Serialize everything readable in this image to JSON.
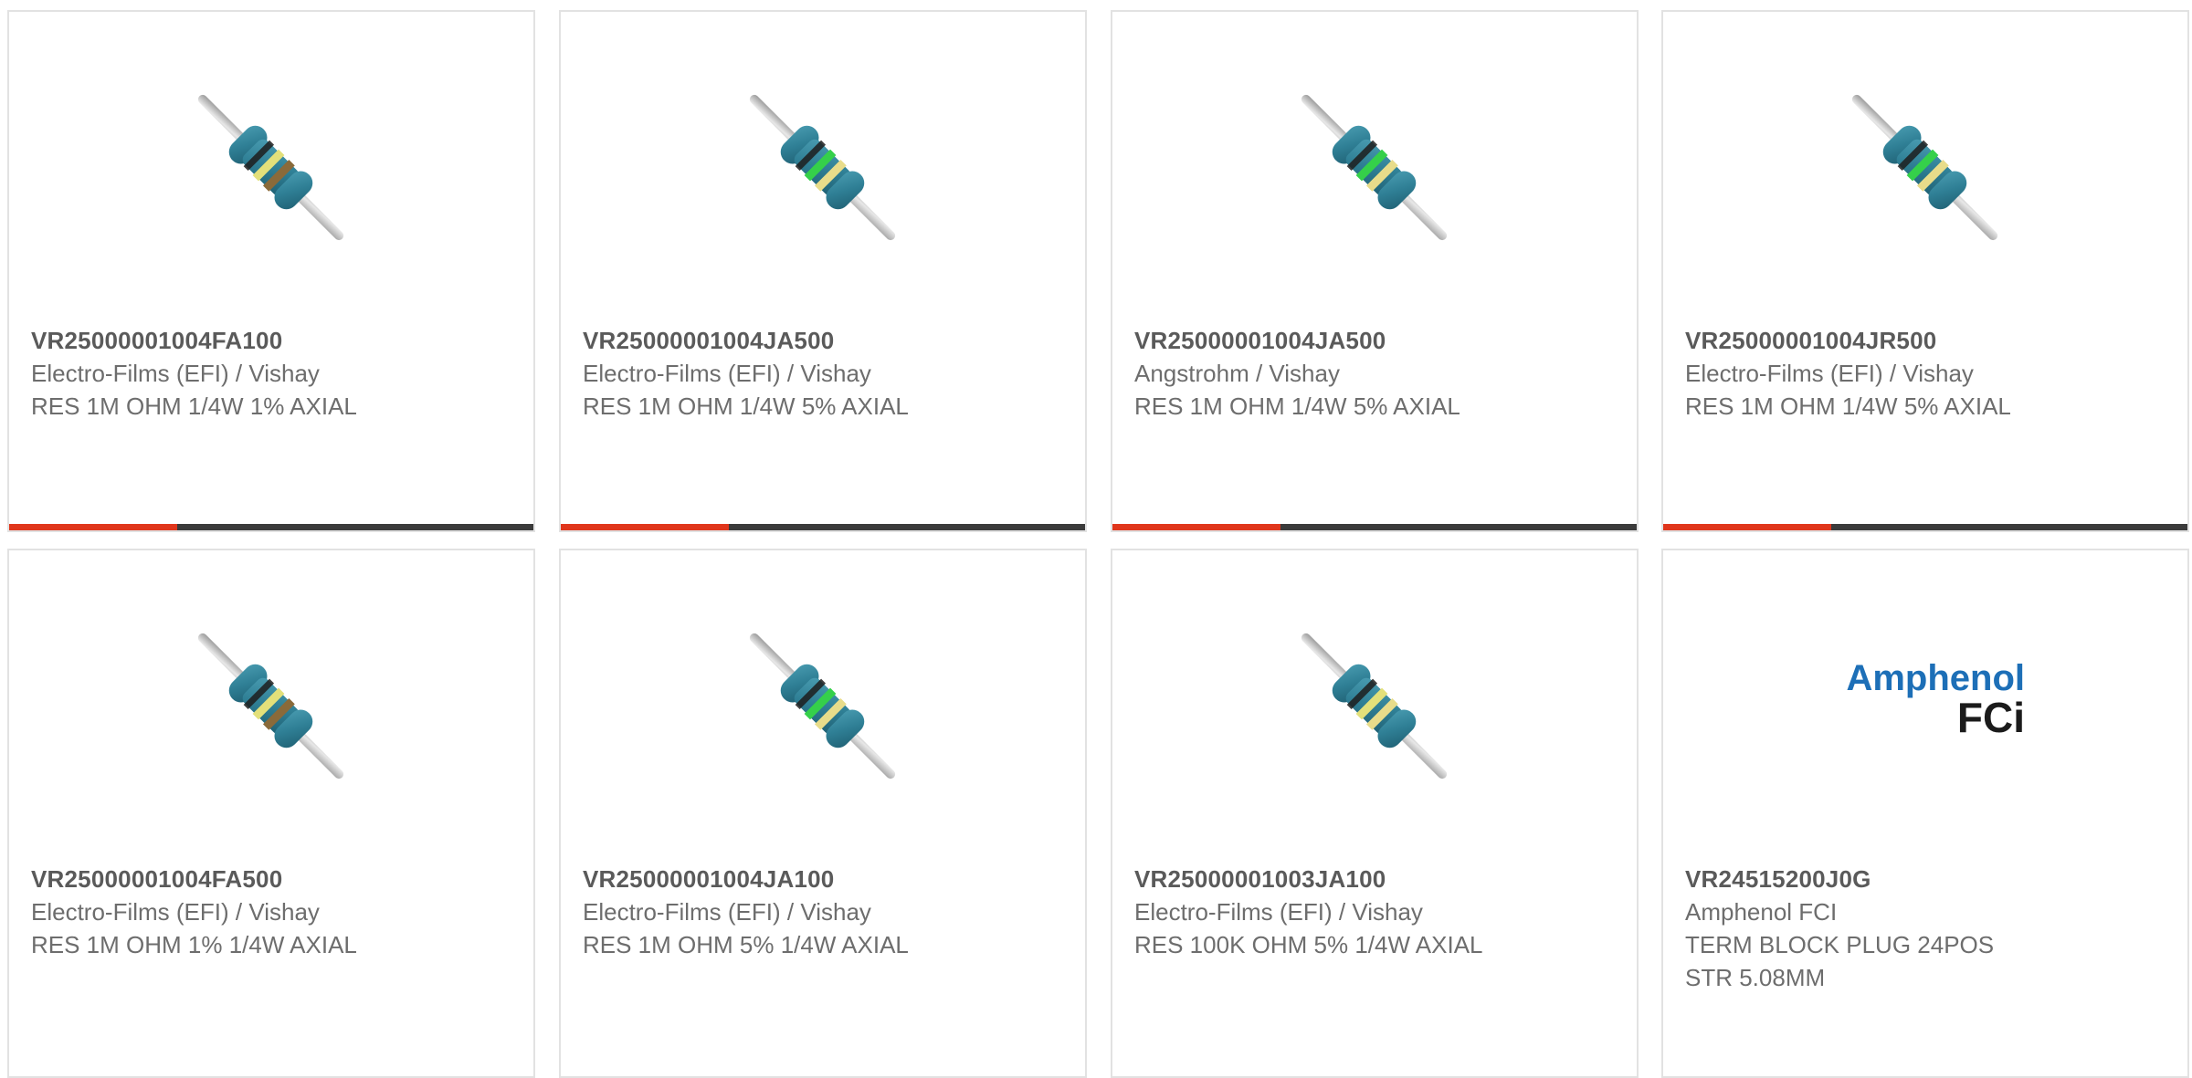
{
  "products": [
    {
      "part_number": "VR25000001004FA100",
      "manufacturer": "Electro-Films (EFI) / Vishay",
      "description": "RES 1M OHM 1/4W 1% AXIAL",
      "thumbnail": "resistor-icon",
      "band_colors": [
        "#1d1d1d",
        "#e3e07a",
        "#8a6a3a"
      ],
      "progress": 0.32
    },
    {
      "part_number": "VR25000001004JA500",
      "manufacturer": "Electro-Films (EFI) / Vishay",
      "description": "RES 1M OHM 1/4W 5% AXIAL",
      "thumbnail": "resistor-icon",
      "band_colors": [
        "#1d1d1d",
        "#35d04a",
        "#e8dc8a"
      ],
      "progress": 0.32
    },
    {
      "part_number": "VR25000001004JA500",
      "manufacturer": "Angstrohm / Vishay",
      "description": "RES 1M OHM 1/4W 5% AXIAL",
      "thumbnail": "resistor-icon",
      "band_colors": [
        "#1d1d1d",
        "#35d04a",
        "#e8dc8a"
      ],
      "progress": 0.32
    },
    {
      "part_number": "VR25000001004JR500",
      "manufacturer": "Electro-Films (EFI) / Vishay",
      "description": "RES 1M OHM 1/4W 5% AXIAL",
      "thumbnail": "resistor-icon",
      "band_colors": [
        "#1d1d1d",
        "#35d04a",
        "#e8dc8a"
      ],
      "progress": 0.32
    },
    {
      "part_number": "VR25000001004FA500",
      "manufacturer": "Electro-Films (EFI) / Vishay",
      "description": "RES 1M OHM 1% 1/4W AXIAL",
      "thumbnail": "resistor-icon",
      "band_colors": [
        "#1d1d1d",
        "#e3e07a",
        "#8a6a3a"
      ]
    },
    {
      "part_number": "VR25000001004JA100",
      "manufacturer": "Electro-Films (EFI) / Vishay",
      "description": "RES 1M OHM 5% 1/4W AXIAL",
      "thumbnail": "resistor-icon",
      "band_colors": [
        "#1d1d1d",
        "#35d04a",
        "#e8dc8a"
      ]
    },
    {
      "part_number": "VR25000001003JA100",
      "manufacturer": "Electro-Films (EFI) / Vishay",
      "description": "RES 100K OHM 5% 1/4W AXIAL",
      "thumbnail": "resistor-icon",
      "band_colors": [
        "#1d1d1d",
        "#e3e07a",
        "#e8dc8a"
      ]
    },
    {
      "part_number": "VR24515200J0G",
      "manufacturer": "Amphenol FCI",
      "description": "TERM BLOCK PLUG 24POS",
      "description_line2": "STR 5.08MM",
      "thumbnail": "amphenol-fci-logo",
      "logo_text_1": "Amphenol",
      "logo_text_2": "FCi"
    }
  ],
  "colors": {
    "accent": "#e0361c",
    "bar": "#3b3b3b",
    "resistor_body": "#2f7f95",
    "lead": "#c9c9c9",
    "logo_blue": "#1d6fb7"
  }
}
